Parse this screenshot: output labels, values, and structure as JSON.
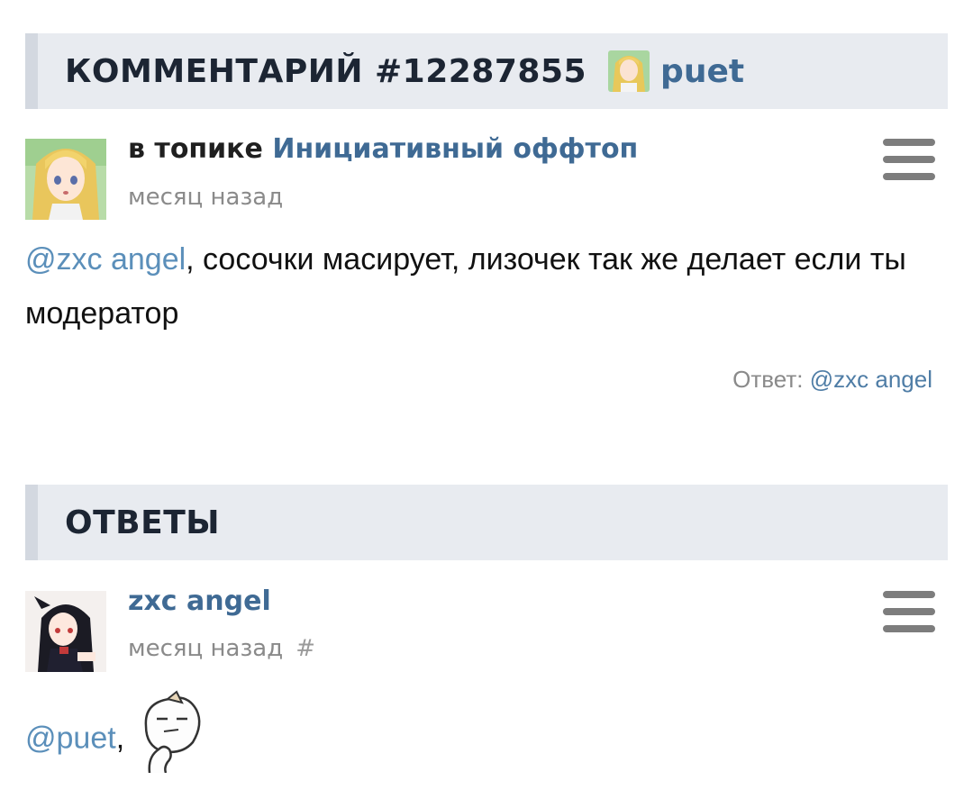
{
  "comment_header": {
    "title": "КОММЕНТАРИЙ #12287855",
    "username": "puet"
  },
  "comment": {
    "topic_prefix": "в топике",
    "topic_name": "Инициативный оффтоп",
    "time": "месяц назад",
    "mention": "@zxc angel",
    "text": ", сосочки масирует, лизочек так же делает если ты модератор",
    "reply_label": "Ответ:",
    "reply_mention": "@zxc angel"
  },
  "answers_header": {
    "title": "ОТВЕТЫ"
  },
  "answer": {
    "username": "zxc angel",
    "time": "месяц назад",
    "hash": "#",
    "mention": "@puet",
    "comma": ","
  },
  "icons": {
    "menu": "hamburger-menu-icon",
    "sticker": "smug-face-sticker-icon"
  },
  "colors": {
    "link": "#3f6a94",
    "mention": "#5b8fba",
    "header_bg": "#e8ebf0"
  }
}
